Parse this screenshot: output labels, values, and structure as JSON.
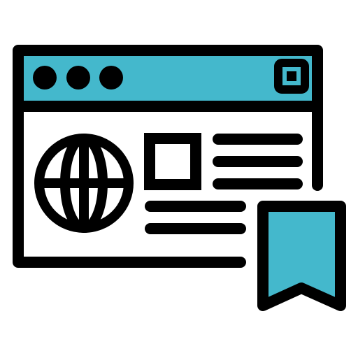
{
  "icon": {
    "name": "bookmarked-web-page-icon",
    "colors": {
      "stroke": "#000000",
      "accent": "#44B8CC",
      "background": "#ffffff"
    },
    "parts": [
      "browser-window",
      "browser-title-bar",
      "window-control-dot",
      "window-maximize-button",
      "globe-icon",
      "image-placeholder",
      "text-line",
      "bookmark-ribbon-icon"
    ]
  }
}
